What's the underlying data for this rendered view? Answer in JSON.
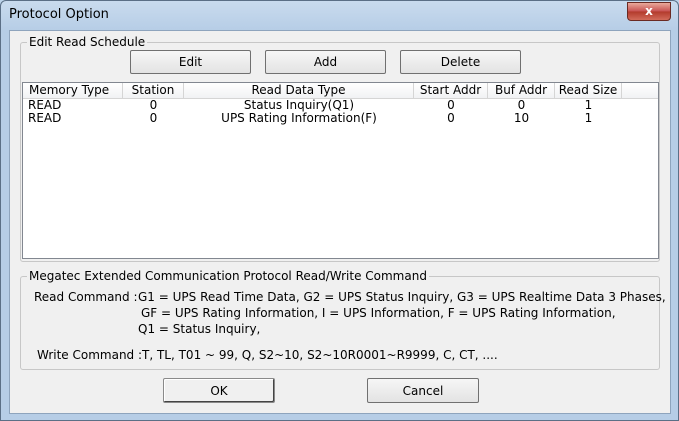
{
  "window": {
    "title": "Protocol Option",
    "close_glyph": "x"
  },
  "schedule": {
    "legend": "Edit Read Schedule",
    "edit_label": "Edit",
    "add_label": "Add",
    "delete_label": "Delete",
    "columns": [
      "Memory Type",
      "Station",
      "Read Data Type",
      "Start Addr",
      "Buf Addr",
      "Read Size"
    ],
    "rows": [
      [
        "READ",
        "0",
        "Status Inquiry(Q1)",
        "0",
        "0",
        "1"
      ],
      [
        "READ",
        "0",
        "UPS Rating Information(F)",
        "0",
        "10",
        "1"
      ]
    ]
  },
  "command": {
    "legend": "Megatec Extended Communication Protocol Read/Write Command",
    "read_label": "Read Command :",
    "read_line1": "G1 = UPS Read Time Data,  G2 = UPS Status Inquiry, G3 = UPS Realtime Data 3 Phases,",
    "read_line2": "GF = UPS Rating Information, I = UPS Information, F = UPS Rating Information,",
    "read_line3": "Q1 = Status Inquiry,",
    "write_label": "Write Command :",
    "write_text": "T,    TL,    T01 ~ 99,    Q,    S2~10,    S2~10R0001~R9999,     C,    CT, ...."
  },
  "footer": {
    "ok_label": "OK",
    "cancel_label": "Cancel"
  }
}
